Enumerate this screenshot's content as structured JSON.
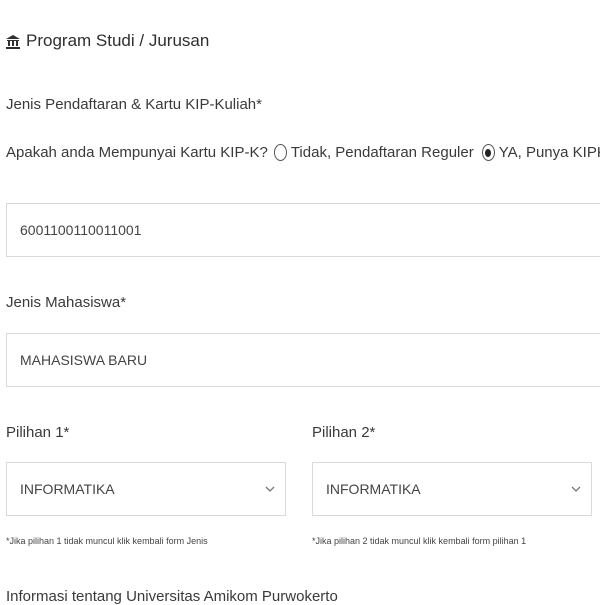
{
  "section": {
    "icon": "bank-icon",
    "title": "Program Studi / Jurusan"
  },
  "kip": {
    "label": "Jenis Pendaftaran & Kartu KIP-Kuliah*",
    "question": "Apakah anda Mempunyai Kartu KIP-K?",
    "option_no": "Tidak, Pendaftaran Reguler",
    "option_yes": "YA, Punya KIPK",
    "selected": "YA, Punya KIPK",
    "number_value": "6001100110011001"
  },
  "jenis_mahasiswa": {
    "label": "Jenis Mahasiswa*",
    "value": "MAHASISWA BARU"
  },
  "pilihan1": {
    "label": "Pilihan 1*",
    "value": "INFORMATIKA",
    "hint": "*Jika pilihan 1 tidak muncul klik kembali form Jenis"
  },
  "pilihan2": {
    "label": "Pilihan 2*",
    "value": "INFORMATIKA",
    "hint": "*Jika pilihan 2 tidak muncul klik kembali form pilihan 1"
  },
  "info": {
    "text": "Informasi tentang Universitas Amikom Purwokerto"
  }
}
